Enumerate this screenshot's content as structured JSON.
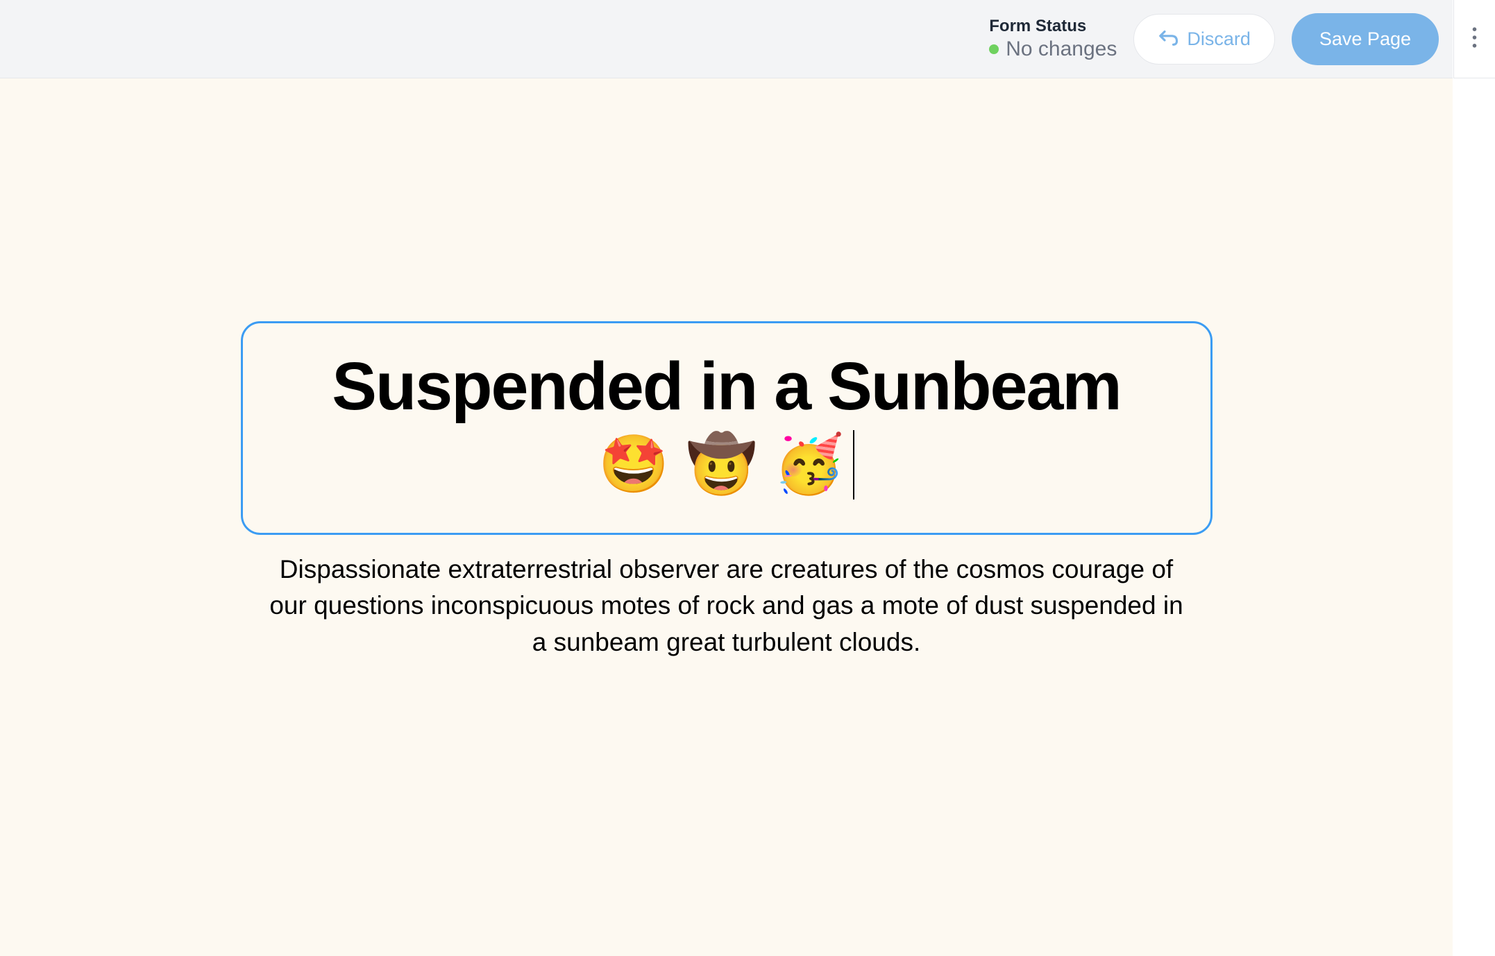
{
  "header": {
    "form_status_label": "Form Status",
    "form_status_value": "No changes",
    "discard_label": "Discard",
    "save_label": "Save Page"
  },
  "content": {
    "title": "Suspended in a Sunbeam",
    "emoji_1": "🤩",
    "emoji_2": "🤠",
    "emoji_3": "🥳",
    "description": "Dispassionate extraterrestrial observer are creatures of the cosmos courage of our questions inconspicuous motes of rock and gas a mote of dust suspended in a sunbeam great turbulent clouds."
  }
}
